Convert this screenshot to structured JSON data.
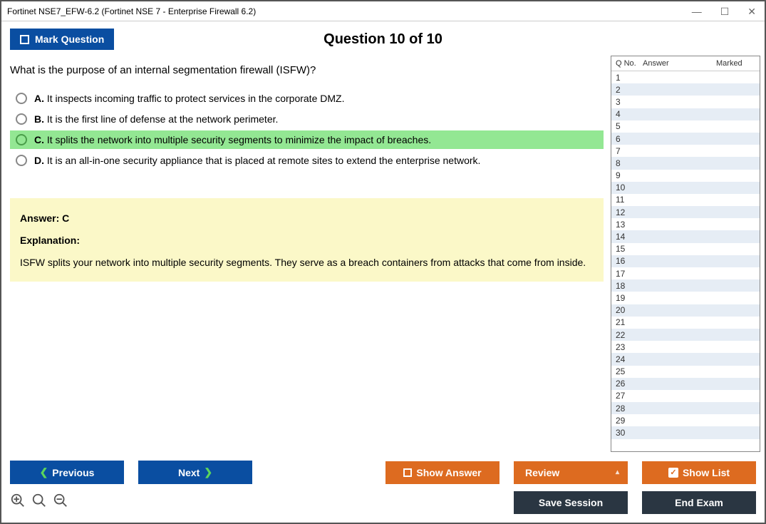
{
  "window": {
    "title": "Fortinet NSE7_EFW-6.2 (Fortinet NSE 7 - Enterprise Firewall 6.2)"
  },
  "header": {
    "mark_label": "Mark Question",
    "question_title": "Question 10 of 10"
  },
  "question": {
    "text": "What is the purpose of an internal segmentation firewall (ISFW)?"
  },
  "options": [
    {
      "letter": "A.",
      "text": " It inspects incoming traffic to protect services in the corporate DMZ.",
      "selected": false
    },
    {
      "letter": "B.",
      "text": " It is the first line of defense at the network perimeter.",
      "selected": false
    },
    {
      "letter": "C.",
      "text": " It splits the network into multiple security segments to minimize the impact of breaches.",
      "selected": true
    },
    {
      "letter": "D.",
      "text": " It is an all-in-one security appliance that is placed at remote sites to extend the enterprise network.",
      "selected": false
    }
  ],
  "answer": {
    "label": "Answer: C",
    "exp_label": "Explanation:",
    "exp_text": "ISFW splits your network into multiple security segments. They serve as a breach containers from attacks that come from inside."
  },
  "grid": {
    "headers": {
      "qno": "Q No.",
      "answer": "Answer",
      "marked": "Marked"
    },
    "rows": [
      1,
      2,
      3,
      4,
      5,
      6,
      7,
      8,
      9,
      10,
      11,
      12,
      13,
      14,
      15,
      16,
      17,
      18,
      19,
      20,
      21,
      22,
      23,
      24,
      25,
      26,
      27,
      28,
      29,
      30
    ]
  },
  "footer": {
    "previous": "Previous",
    "next": "Next",
    "show_answer": "Show Answer",
    "review": "Review",
    "show_list": "Show List",
    "save_session": "Save Session",
    "end_exam": "End Exam"
  }
}
